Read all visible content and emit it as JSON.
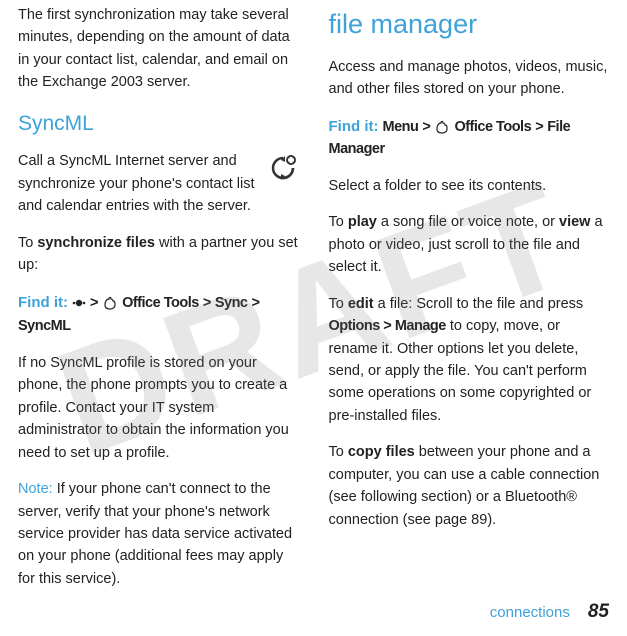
{
  "watermark": "DRAFT",
  "left": {
    "intro": "The first synchronization may take several minutes, depending on the amount of data in your contact list, calendar, and email on the Exchange 2003 server.",
    "syncml_heading": "SyncML",
    "syncml_text": "Call a SyncML Internet server and synchronize your phone's contact list and calendar entries with the server.",
    "sync_files_lead": "To ",
    "sync_files_bold": "synchronize files",
    "sync_files_tail": " with a partner you set up:",
    "findit_label": "Find it:",
    "findit_path": {
      "gt1": ">",
      "officetools": "Office Tools",
      "gt2": ">",
      "sync": "Sync",
      "gt3": ">",
      "syncml": "SyncML"
    },
    "no_profile": "If no SyncML profile is stored on your phone, the phone prompts you to create a profile. Contact your IT system administrator to obtain the information you need to set up a profile.",
    "note_label": "Note:",
    "note_text": " If your phone can't connect to the server, verify that your phone's network service provider has data service activated on your phone (additional fees may apply for this service)."
  },
  "right": {
    "fm_heading": "file manager",
    "fm_intro": "Access and manage photos, videos, music, and other files stored on your phone.",
    "findit_label": "Find it:",
    "findit_path": {
      "menu": "Menu",
      "gt1": ">",
      "officetools": "Office Tools",
      "gt2": ">",
      "filemanager": "File Manager"
    },
    "select_folder": "Select a folder to see its contents.",
    "play_lead": "To ",
    "play_bold": "play",
    "play_mid": " a song file or voice note, or ",
    "view_bold": "view",
    "play_tail": " a photo or video, just scroll to the file and select it.",
    "edit_lead": "To ",
    "edit_bold": "edit",
    "edit_mid": " a file: Scroll to the file and press ",
    "options": "Options",
    "edit_gt": " > ",
    "manage": "Manage",
    "edit_tail": " to copy, move, or rename it. Other options let you delete, send, or apply the file. You can't perform some operations on some copyrighted or pre-installed files.",
    "copy_lead": "To ",
    "copy_bold": "copy files",
    "copy_tail": " between your phone and a computer, you can use a cable connection (see following section) or a Bluetooth® connection (see page 89)."
  },
  "footer": {
    "section": "connections",
    "page": "85"
  }
}
